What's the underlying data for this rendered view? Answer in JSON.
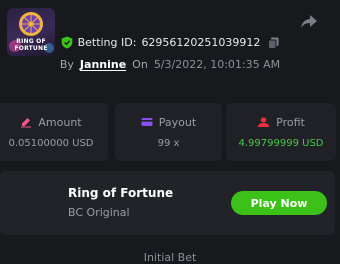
{
  "header": {
    "share_icon": "share-icon",
    "bet_id_label": "Betting ID:",
    "bet_id": "62956120251039912",
    "shield_icon": "shield-check-icon",
    "copy_icon": "copy-icon",
    "by_label": "By",
    "username": "Jannine",
    "on_label": "On",
    "datetime": "5/3/2022, 10:01:35 AM"
  },
  "stats": {
    "amount": {
      "icon": "pencil-icon",
      "label": "Amount",
      "value": "0.05100000 USD"
    },
    "payout": {
      "icon": "card-icon",
      "label": "Payout",
      "value": "99 x"
    },
    "profit": {
      "icon": "coins-icon",
      "label": "Profit",
      "value": "4.99799999 USD"
    }
  },
  "game": {
    "thumbnail_text_1": "RING OF",
    "thumbnail_text_2": "FORTUNE",
    "title": "Ring of Fortune",
    "subtitle": "BC Original",
    "play_label": "Play Now"
  },
  "section": {
    "initial_bet_label": "Initial Bet"
  },
  "colors": {
    "background": "#18191d",
    "card": "#202126",
    "accent_green": "#3bc117",
    "profit_green": "#46c84a",
    "amount_icon": "#f0568a",
    "payout_icon": "#8a4ff3",
    "profit_icon": "#e5333f",
    "shield_green": "#3bc117"
  }
}
